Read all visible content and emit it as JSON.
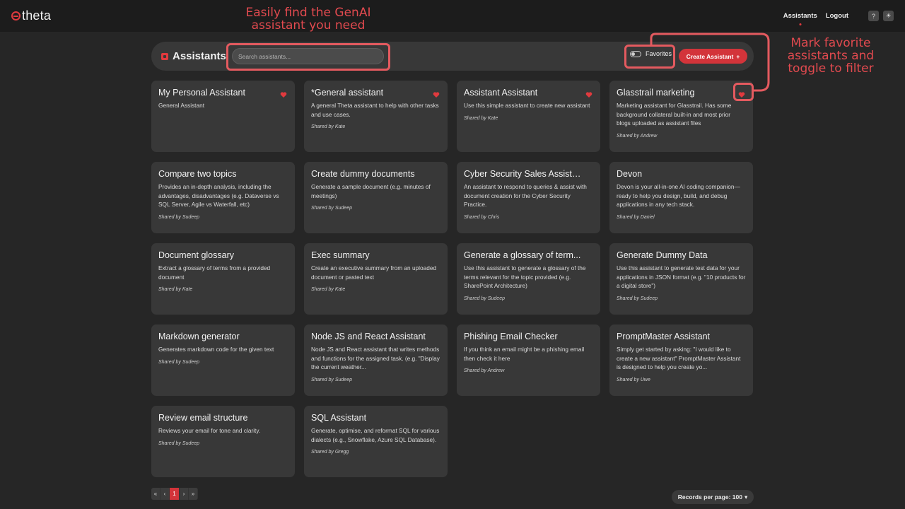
{
  "app": {
    "logo_text": "theta",
    "accent": "#d3343a"
  },
  "nav": {
    "assistants": "Assistants",
    "logout": "Logout",
    "help_icon": "?",
    "theme_icon": "☀"
  },
  "header": {
    "title": "Assistants",
    "search_placeholder": "Search assistants...",
    "favorites_label": "Favorites",
    "create_label": "Create Assistant",
    "create_plus": "+"
  },
  "annotations": {
    "search_note": "Easily find the GenAI assistant you need",
    "favorites_note": "Mark favorite assistants and toggle to filter"
  },
  "cards": [
    {
      "title": "My Personal Assistant",
      "desc": "General Assistant",
      "shared": "",
      "heart": "filled"
    },
    {
      "title": "*General assistant",
      "desc": "A general Theta assistant to help with other tasks and use cases.",
      "shared": "Shared by Kate",
      "heart": "filled"
    },
    {
      "title": "Assistant Assistant",
      "desc": "Use this simple assistant to create new assistant",
      "shared": "Shared by Kate",
      "heart": "filled"
    },
    {
      "title": "Glasstrail marketing",
      "desc": "Marketing assistant for Glasstrail. Has some background collateral built-in and most prior blogs uploaded as assistant files",
      "shared": "Shared by Andrew",
      "heart": "filled"
    },
    {
      "title": "Compare two topics",
      "desc": "Provides an in-depth analysis, including the advantages, disadvantages (e.g. Dataverse vs SQL Server, Agile vs Waterfall, etc)",
      "shared": "Shared by Sudeep",
      "heart": "none"
    },
    {
      "title": "Create dummy documents",
      "desc": "Generate a sample document (e.g. minutes of meetings)",
      "shared": "Shared by Sudeep",
      "heart": "none"
    },
    {
      "title": "Cyber Security Sales Assistant",
      "desc": "An assistant to respond to queries & assist with document creation for the Cyber Security Practice.",
      "shared": "Shared by Chris",
      "heart": "none"
    },
    {
      "title": "Devon",
      "desc": "Devon is your all-in-one AI coding companion—ready to help you design, build, and debug applications in any tech stack.",
      "shared": "Shared by Daniel",
      "heart": "none"
    },
    {
      "title": "Document glossary",
      "desc": "Extract a glossary of terms from a provided document",
      "shared": "Shared by Kate",
      "heart": "none"
    },
    {
      "title": "Exec summary",
      "desc": "Create an executive summary from an uploaded document or pasted text",
      "shared": "Shared by Kate",
      "heart": "none"
    },
    {
      "title": "Generate a glossary of term...",
      "desc": "Use this assistant to generate a glossary of the terms relevant for the topic provided (e.g. SharePoint Architecture)",
      "shared": "Shared by Sudeep",
      "heart": "none"
    },
    {
      "title": "Generate Dummy Data",
      "desc": "Use this assistant to generate test data for your applications in JSON format (e.g. \"10 products for a digital store\")",
      "shared": "Shared by Sudeep",
      "heart": "none"
    },
    {
      "title": "Markdown generator",
      "desc": "Generates markdown code for the given text",
      "shared": "Shared by Sudeep",
      "heart": "none"
    },
    {
      "title": "Node JS and React Assistant",
      "desc": "Node JS and React assistant that writes methods and functions for the assigned task. (e.g. \"Display the current weather...",
      "shared": "Shared by Sudeep",
      "heart": "none"
    },
    {
      "title": "Phishing Email Checker",
      "desc": "If you think an email might be a phishing email then check it here",
      "shared": "Shared by Andrew",
      "heart": "none"
    },
    {
      "title": "PromptMaster Assistant",
      "desc": "Simply get started by asking: \"I would like to create a new assistant\" PromptMaster Assistant is designed to help you create yo...",
      "shared": "Shared by Uwe",
      "heart": "none"
    },
    {
      "title": "Review email structure",
      "desc": "Reviews your email for tone and clarity.",
      "shared": "Shared by Sudeep",
      "heart": "none"
    },
    {
      "title": "SQL Assistant",
      "desc": "Generate, optimise, and reformat SQL for various dialects (e.g., Snowflake, Azure SQL Database).",
      "shared": "Shared by Gregg",
      "heart": "none"
    }
  ],
  "pagination": {
    "first": "«",
    "prev": "‹",
    "current": "1",
    "next": "›",
    "last": "»"
  },
  "records": {
    "label": "Records per page: 100",
    "caret": "▾"
  }
}
